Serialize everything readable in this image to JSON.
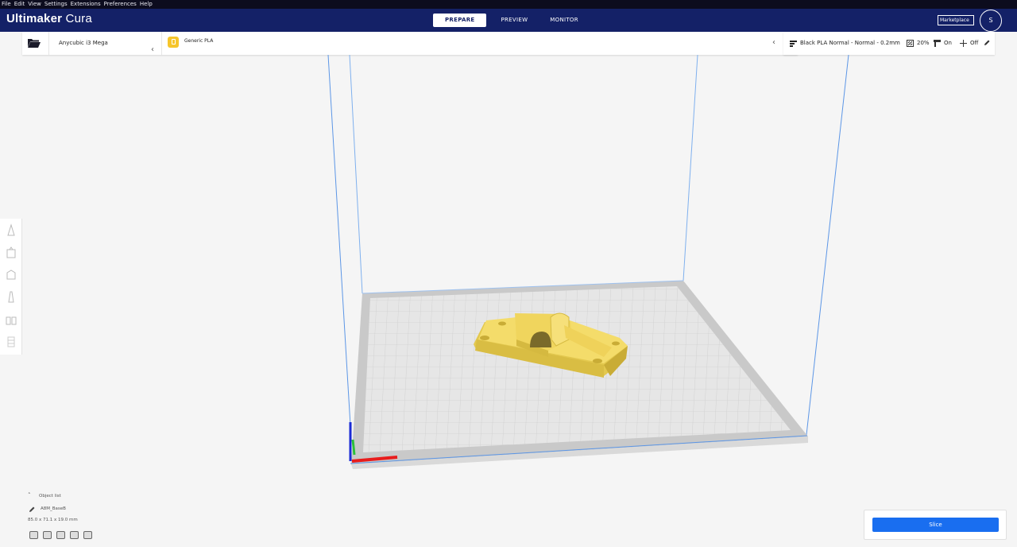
{
  "menu": [
    "File",
    "Edit",
    "View",
    "Settings",
    "Extensions",
    "Preferences",
    "Help"
  ],
  "app": {
    "brand_bold": "Ultimaker",
    "brand_light": "Cura"
  },
  "tabs": [
    {
      "label": "PREPARE",
      "active": true
    },
    {
      "label": "PREVIEW",
      "active": false
    },
    {
      "label": "MONITOR",
      "active": false
    }
  ],
  "header": {
    "marketplace": "Marketplace",
    "avatar": "S"
  },
  "printer": {
    "name": "Anycubic i3 Mega"
  },
  "material": {
    "name": "Generic PLA"
  },
  "print_settings": {
    "profile": "Black PLA Normal - Normal - 0.2mm",
    "infill": "20%",
    "support": "On",
    "adhesion": "Off"
  },
  "objects": {
    "toggle_label": "Object list",
    "name": "A8M_BaseB",
    "dimensions": "85.0 x 71.1 x 19.0 mm"
  },
  "actions": {
    "slice": "Slice"
  },
  "icons": {
    "open": "folder-open-icon",
    "material": "spool-icon",
    "profile": "profile-icon",
    "infill": "infill-icon",
    "support": "support-icon",
    "adhesion": "adhesion-icon",
    "edit": "pencil-icon"
  },
  "colors": {
    "brand": "#142167",
    "accent": "#196ef0",
    "model": "#f4dc6a",
    "build_volume": "#5c96e6"
  }
}
